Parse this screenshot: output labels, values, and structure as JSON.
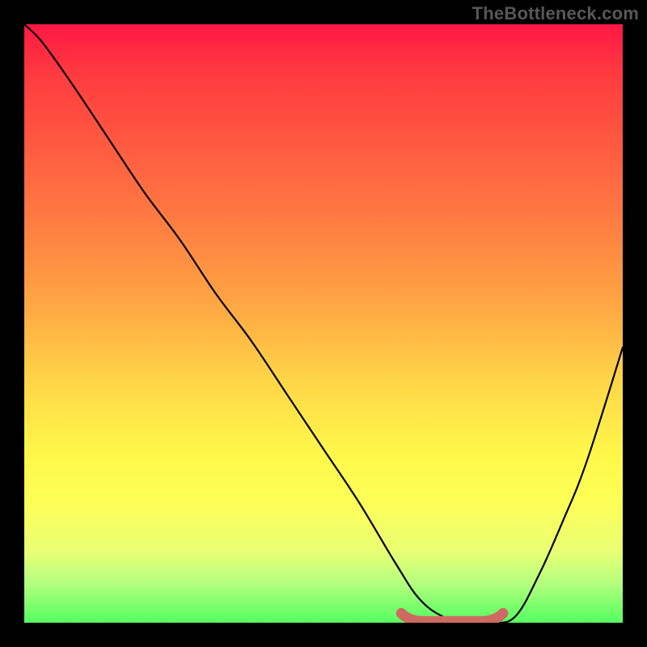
{
  "watermark": "TheBottleneck.com",
  "colors": {
    "background": "#000000",
    "curve": "#000000",
    "marker": "#cf6a62",
    "gradient_top": "#ff1744",
    "gradient_bottom": "#55ff61"
  },
  "chart_data": {
    "type": "line",
    "title": "",
    "xlabel": "",
    "ylabel": "",
    "xlim": [
      0,
      100
    ],
    "ylim": [
      0,
      100
    ],
    "grid": false,
    "legend": false,
    "x": [
      0,
      3,
      8,
      14,
      20,
      26,
      32,
      38,
      44,
      50,
      56,
      62,
      66,
      70,
      74,
      78,
      82,
      86,
      90,
      94,
      100
    ],
    "values": [
      100,
      97,
      90,
      81,
      72,
      64,
      55,
      47,
      38,
      29,
      20,
      10,
      4,
      1,
      0,
      0,
      1,
      8,
      17,
      27,
      46
    ],
    "marker_region": {
      "x_start": 63,
      "x_end": 80,
      "y": 0.5
    },
    "annotations": []
  }
}
